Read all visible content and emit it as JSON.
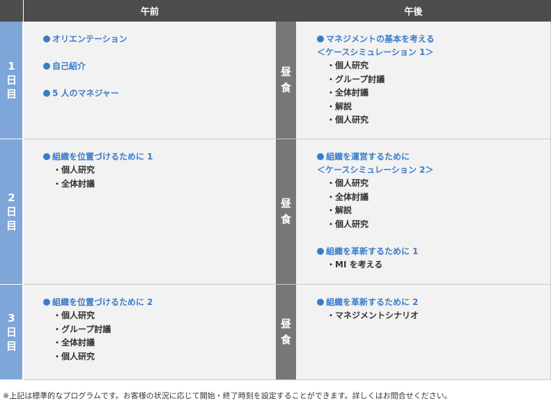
{
  "header": {
    "morning": "午前",
    "afternoon": "午後"
  },
  "lunch_label": [
    "昼",
    "食"
  ],
  "days": [
    {
      "label": [
        "1",
        "日",
        "目"
      ],
      "morning": [
        {
          "type": "heading",
          "text": "オリエンテーション"
        },
        {
          "type": "gap"
        },
        {
          "type": "heading",
          "text": "自己紹介"
        },
        {
          "type": "gap"
        },
        {
          "type": "heading",
          "text": "5 人のマネジャー"
        }
      ],
      "afternoon": [
        {
          "type": "heading",
          "text": "マネジメントの基本を考える"
        },
        {
          "type": "sub",
          "text": "＜ケースシミュレーション 1＞"
        },
        {
          "type": "item",
          "text": "・個人研究"
        },
        {
          "type": "item",
          "text": "・グループ討議"
        },
        {
          "type": "item",
          "text": "・全体討議"
        },
        {
          "type": "item",
          "text": "・解説"
        },
        {
          "type": "item",
          "text": "・個人研究"
        }
      ]
    },
    {
      "label": [
        "2",
        "日",
        "目"
      ],
      "morning": [
        {
          "type": "heading",
          "text": "組織を位置づけるために 1"
        },
        {
          "type": "item",
          "text": "・個人研究"
        },
        {
          "type": "item",
          "text": "・全体討議"
        }
      ],
      "afternoon": [
        {
          "type": "heading",
          "text": "組織を運営するために"
        },
        {
          "type": "sub",
          "text": "＜ケースシミュレーション 2＞"
        },
        {
          "type": "item",
          "text": "・個人研究"
        },
        {
          "type": "item",
          "text": "・全体討議"
        },
        {
          "type": "item",
          "text": "・解説"
        },
        {
          "type": "item",
          "text": "・個人研究"
        },
        {
          "type": "gap"
        },
        {
          "type": "heading",
          "text": "組織を革新するために 1"
        },
        {
          "type": "item",
          "text": "・MI を考える"
        }
      ]
    },
    {
      "label": [
        "3",
        "日",
        "目"
      ],
      "morning": [
        {
          "type": "heading",
          "text": "組織を位置づけるために 2"
        },
        {
          "type": "item",
          "text": "・個人研究"
        },
        {
          "type": "item",
          "text": "・グループ討議"
        },
        {
          "type": "item",
          "text": "・全体討議"
        },
        {
          "type": "item",
          "text": "・個人研究"
        }
      ],
      "afternoon": [
        {
          "type": "heading",
          "text": "組織を革新するために 2"
        },
        {
          "type": "item",
          "text": "・マネジメントシナリオ"
        }
      ]
    }
  ],
  "footnote": "※上記は標準的なプログラムです。お客様の状況に応じて開始・終了時刻を設定することができます。詳しくはお問合せください。",
  "colors": {
    "header_bg": "#4d4d4d",
    "day_bg": "#7fa6d8",
    "lunch_bg": "#777777",
    "cell_bg": "#f2f2f2",
    "heading_text": "#3a7bc8",
    "item_text": "#333333"
  }
}
